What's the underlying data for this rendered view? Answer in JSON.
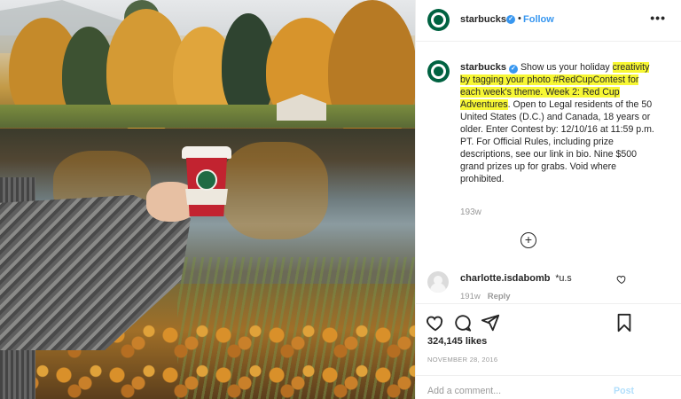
{
  "post": {
    "username": "starbucks",
    "follow_label": "Follow",
    "separator": "•",
    "more_label": "•••"
  },
  "caption": {
    "username": "starbucks",
    "text_plain_1": "Show us your holiday ",
    "text_highlight": "creativity by tagging your photo #RedCupContest for each week's theme. Week 2: Red Cup Adventures",
    "text_plain_2": ". Open to Legal residents of the 50 United States (D.C.) and Canada, 18 years or older. Enter Contest by: 12/10/16 at 11:59 p.m. PT. For Official Rules, including prize descriptions, see our link in bio. Nine $500 grand prizes up for grabs. Void where prohibited.",
    "time": "193w",
    "load_more_icon": "plus-circle-icon"
  },
  "comment": {
    "username": "charlotte.isdabomb",
    "text": "*u.s",
    "time": "191w",
    "reply_label": "Reply"
  },
  "actions": {
    "likes": "324,145 likes",
    "date": "NOVEMBER 28, 2016",
    "add_comment_placeholder": "Add a comment...",
    "post_label": "Post"
  },
  "colors": {
    "brand_green": "#006241",
    "link_blue": "#3897f0",
    "highlight": "#f7f734",
    "post_disabled": "#b2dffc"
  }
}
